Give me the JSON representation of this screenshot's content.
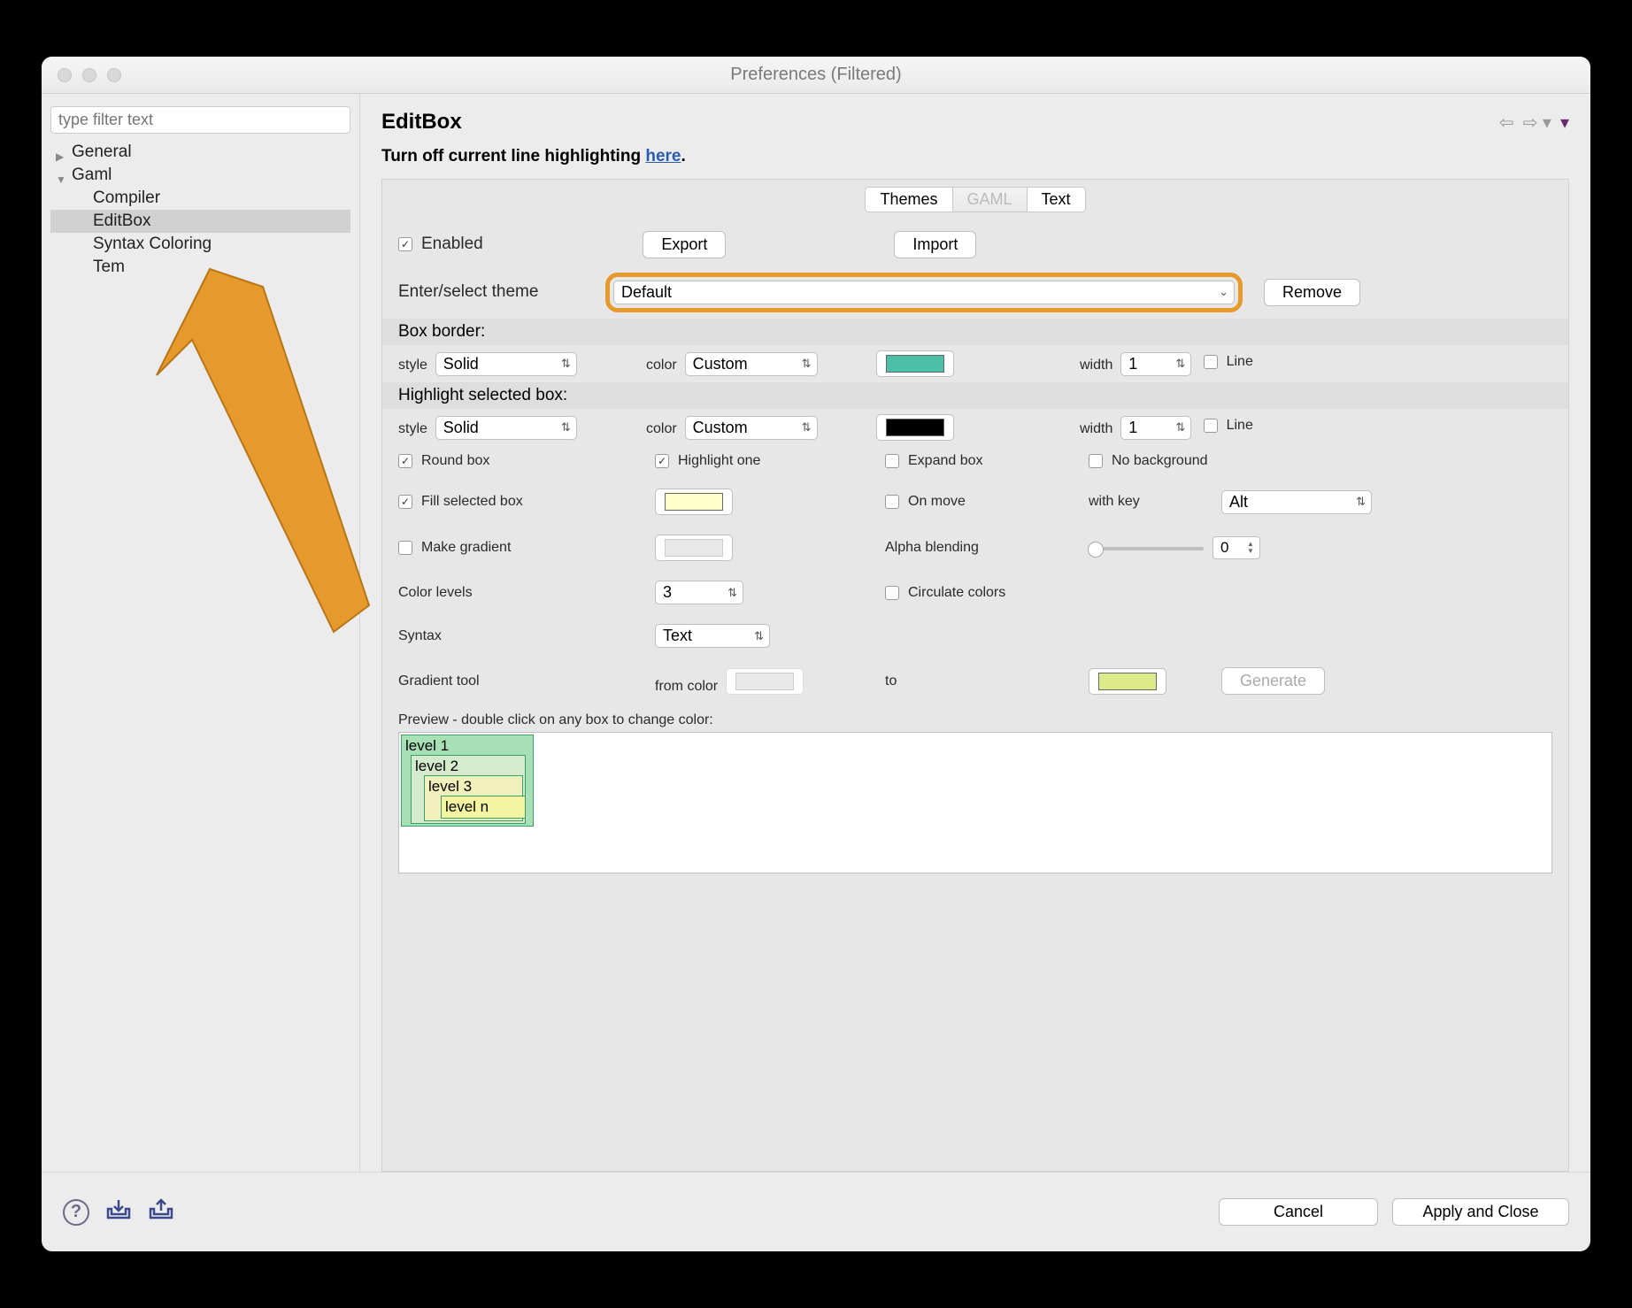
{
  "window": {
    "title": "Preferences (Filtered)"
  },
  "sidebar": {
    "filter_placeholder": "type filter text",
    "items": {
      "general": "General",
      "gaml": "Gaml",
      "compiler": "Compiler",
      "editbox": "EditBox",
      "syntax": "Syntax Coloring",
      "templates": "Tem"
    }
  },
  "page": {
    "title": "EditBox",
    "hint_prefix": "Turn off current line highlighting ",
    "hint_link": "here",
    "hint_suffix": "."
  },
  "tabs": {
    "themes": "Themes",
    "gaml": "GAML",
    "text": "Text"
  },
  "toolbar": {
    "enabled": "Enabled",
    "export": "Export",
    "import": "Import",
    "enter_select": "Enter/select theme",
    "theme_value": "Default",
    "remove": "Remove"
  },
  "section": {
    "box_border": "Box border:",
    "highlight_box": "Highlight selected box:",
    "style": "style",
    "color": "color",
    "width": "width",
    "line": "Line",
    "solid": "Solid",
    "custom": "Custom",
    "one": "1"
  },
  "opts": {
    "round_box": "Round box",
    "highlight_one": "Highlight one",
    "expand_box": "Expand box",
    "no_background": "No background",
    "fill_selected": "Fill selected box",
    "on_move": "On move",
    "with_key": "with key",
    "alt": "Alt",
    "make_gradient": "Make gradient",
    "alpha": "Alpha blending",
    "alpha_val": "0",
    "color_levels": "Color levels",
    "levels_val": "3",
    "circulate": "Circulate colors",
    "syntax": "Syntax",
    "syntax_val": "Text",
    "gradient_tool": "Gradient tool",
    "from_color": "from color",
    "to": "to",
    "generate": "Generate"
  },
  "preview": {
    "title": "Preview - double click on any box to change color:",
    "l1": "level 1",
    "l2": "level 2",
    "l3": "level 3",
    "ln": "level n"
  },
  "footer": {
    "cancel": "Cancel",
    "apply": "Apply and Close"
  }
}
